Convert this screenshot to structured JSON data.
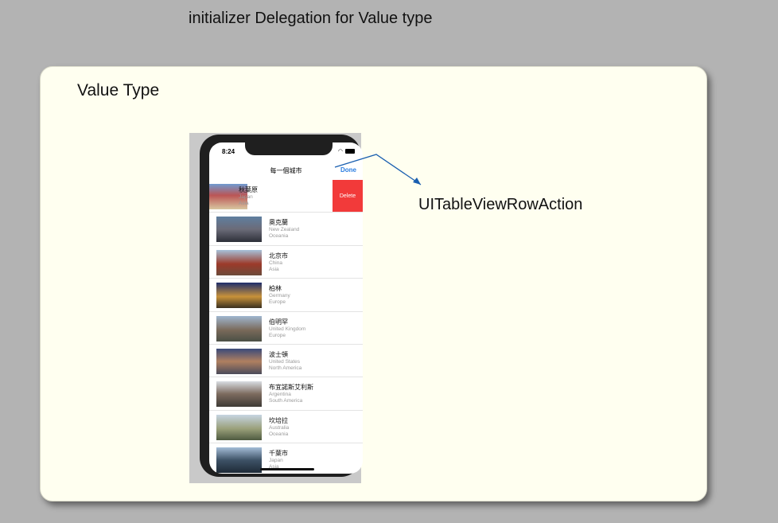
{
  "slide": {
    "title": "initializer Delegation for Value type"
  },
  "card": {
    "title": "Value Type",
    "callout": "UITableViewRowAction"
  },
  "phone": {
    "status_time": "8:24",
    "nav_title": "每一個城市",
    "done_label": "Done",
    "delete_label": "Delete",
    "rows": [
      {
        "name": "秋葉原",
        "country": "Japan",
        "continent": "Asia"
      },
      {
        "name": "奧克蘭",
        "country": "New Zealand",
        "continent": "Oceania"
      },
      {
        "name": "北京市",
        "country": "China",
        "continent": "Asia"
      },
      {
        "name": "柏林",
        "country": "Germany",
        "continent": "Europe"
      },
      {
        "name": "伯明罕",
        "country": "United Kingdom",
        "continent": "Europe"
      },
      {
        "name": "波士頓",
        "country": "United States",
        "continent": "North America"
      },
      {
        "name": "布宜諾斯艾利斯",
        "country": "Argentina",
        "continent": "South America"
      },
      {
        "name": "坎培拉",
        "country": "Australia",
        "continent": "Oceania"
      },
      {
        "name": "千葉市",
        "country": "Japan",
        "continent": "Asia"
      }
    ]
  },
  "colors": {
    "delete": "#f23a3a",
    "accent": "#2a7de1",
    "arrow": "#1a5fb0"
  }
}
